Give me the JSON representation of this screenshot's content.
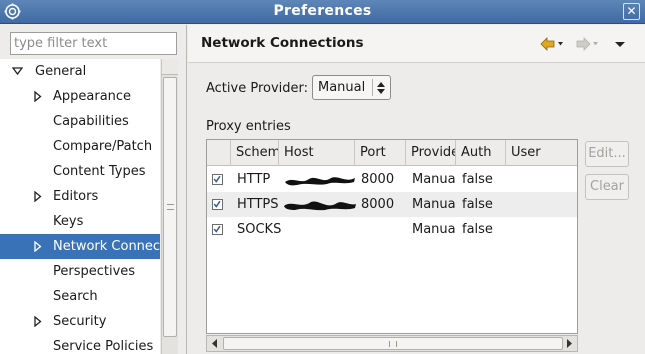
{
  "window": {
    "title": "Preferences"
  },
  "sidebar": {
    "filter_placeholder": "type filter text",
    "items": [
      {
        "label": "General",
        "level": 0,
        "twisty": "expanded"
      },
      {
        "label": "Appearance",
        "level": 1,
        "twisty": "collapsed"
      },
      {
        "label": "Capabilities",
        "level": 1,
        "twisty": "none"
      },
      {
        "label": "Compare/Patch",
        "level": 1,
        "twisty": "none"
      },
      {
        "label": "Content Types",
        "level": 1,
        "twisty": "none"
      },
      {
        "label": "Editors",
        "level": 1,
        "twisty": "collapsed"
      },
      {
        "label": "Keys",
        "level": 1,
        "twisty": "none"
      },
      {
        "label": "Network Connections",
        "level": 1,
        "twisty": "collapsed",
        "selected": true
      },
      {
        "label": "Perspectives",
        "level": 1,
        "twisty": "none"
      },
      {
        "label": "Search",
        "level": 1,
        "twisty": "none"
      },
      {
        "label": "Security",
        "level": 1,
        "twisty": "collapsed"
      },
      {
        "label": "Service Policies",
        "level": 1,
        "twisty": "none"
      }
    ]
  },
  "page": {
    "title": "Network Connections",
    "provider_label": "Active Provider:",
    "provider_value": "Manual",
    "proxy_label": "Proxy entries",
    "columns": [
      "Schema",
      "Host",
      "Port",
      "Provider",
      "Auth",
      "User"
    ],
    "rows": [
      {
        "checked": true,
        "scheme": "HTTP",
        "port": "8000",
        "provider": "Manual",
        "auth": "false",
        "user": ""
      },
      {
        "checked": true,
        "scheme": "HTTPS",
        "port": "8000",
        "provider": "Manual",
        "auth": "false",
        "user": ""
      },
      {
        "checked": true,
        "scheme": "SOCKS",
        "port": "",
        "provider": "Manual",
        "auth": "false",
        "user": ""
      }
    ],
    "edit_label": "Edit...",
    "clear_label": "Clear"
  },
  "colors": {
    "title_bar": "#4a76ad",
    "selection": "#3a72b8",
    "back_arrow": "#e0a81e"
  },
  "icons": [
    "eclipse-icon",
    "close-icon",
    "back-arrow-icon",
    "forward-arrow-icon",
    "view-menu-icon",
    "checkbox-checked-icon",
    "combo-arrow-icon",
    "expand-triangle-icon",
    "collapse-triangle-icon"
  ]
}
